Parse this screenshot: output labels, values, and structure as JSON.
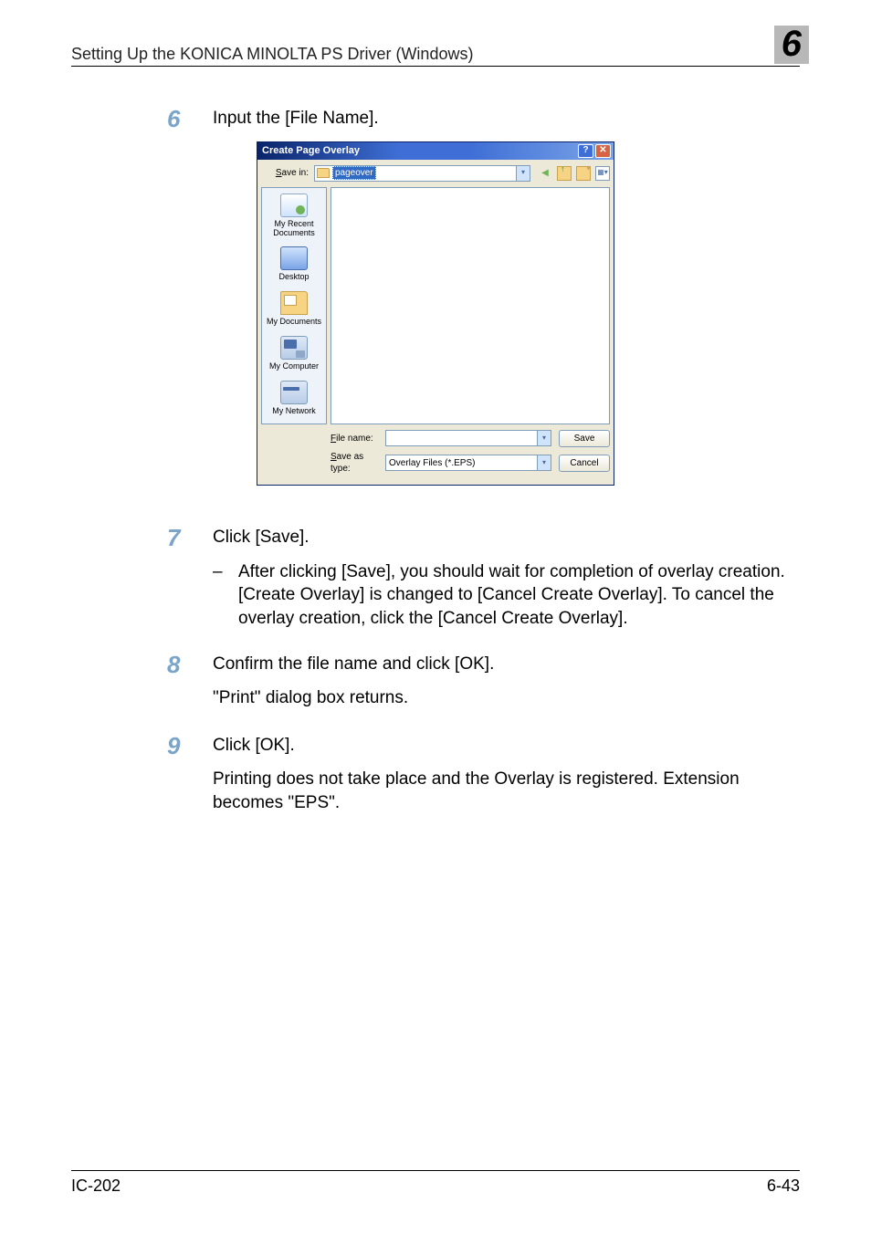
{
  "header": {
    "title": "Setting Up the KONICA MINOLTA PS Driver (Windows)",
    "chapter": "6"
  },
  "steps": {
    "s6": {
      "num": "6",
      "text": "Input the [File Name]."
    },
    "s7": {
      "num": "7",
      "text": "Click [Save].",
      "bullet": "After clicking [Save], you should wait for completion of overlay creation. [Create Overlay] is changed to [Cancel Create Overlay]. To cancel the overlay creation, click the [Cancel Create Overlay]."
    },
    "s8": {
      "num": "8",
      "text": "Confirm the file name and click [OK].",
      "para2": "\"Print\" dialog box returns."
    },
    "s9": {
      "num": "9",
      "text": "Click [OK].",
      "para2": "Printing does not take place and the Overlay is registered. Extension becomes \"EPS\"."
    }
  },
  "dialog": {
    "title": "Create Page Overlay",
    "savein_label": "Save in:",
    "savein_value": "pageover",
    "places": {
      "recent": "My Recent\nDocuments",
      "desktop": "Desktop",
      "mydocs": "My Documents",
      "mycomp": "My Computer",
      "mynet": "My Network"
    },
    "filename_label": "File name:",
    "filename_value": "",
    "savetype_label": "Save as type:",
    "savetype_value": "Overlay Files (*.EPS)",
    "save_btn": "Save",
    "cancel_btn": "Cancel"
  },
  "footer": {
    "left": "IC-202",
    "right": "6-43"
  }
}
